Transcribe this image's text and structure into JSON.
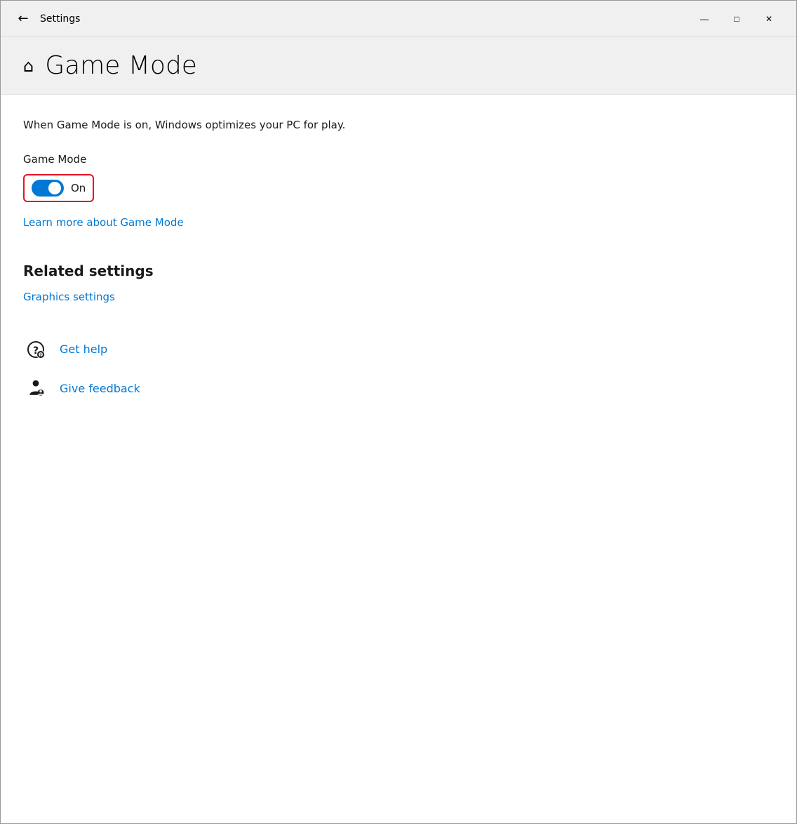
{
  "window": {
    "title": "Settings"
  },
  "titlebar": {
    "back_label": "←",
    "minimize_label": "—",
    "maximize_label": "□",
    "close_label": "✕"
  },
  "header": {
    "home_icon": "⌂",
    "title": "Game Mode"
  },
  "content": {
    "description": "When Game Mode is on, Windows optimizes your PC for play.",
    "toggle_section_label": "Game Mode",
    "toggle_state": "On",
    "toggle_is_on": true,
    "learn_more_link": "Learn more about Game Mode",
    "related_settings_heading": "Related settings",
    "graphics_settings_link": "Graphics settings",
    "get_help_link": "Get help",
    "give_feedback_link": "Give feedback"
  }
}
